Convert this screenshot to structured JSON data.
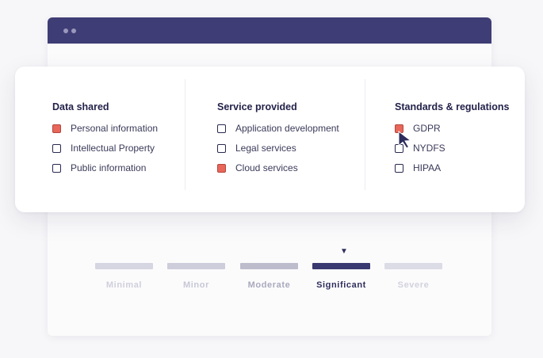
{
  "panel": {
    "columns": [
      {
        "title": "Data shared",
        "options": [
          {
            "label": "Personal information",
            "checked": true
          },
          {
            "label": "Intellectual Property",
            "checked": false
          },
          {
            "label": "Public information",
            "checked": false
          }
        ]
      },
      {
        "title": "Service provided",
        "options": [
          {
            "label": "Application development",
            "checked": false
          },
          {
            "label": "Legal services",
            "checked": false
          },
          {
            "label": "Cloud services",
            "checked": true
          }
        ]
      },
      {
        "title": "Standards & regulations",
        "options": [
          {
            "label": "GDPR",
            "checked": true
          },
          {
            "label": "NYDFS",
            "checked": false
          },
          {
            "label": "HIPAA",
            "checked": false
          }
        ]
      }
    ]
  },
  "scale": {
    "marker_icon": "triangle-down-icon",
    "selected": "Significant",
    "levels": [
      {
        "label": "Minimal",
        "bar_color": "#d6d6e2",
        "text_color": "#cfcfdc"
      },
      {
        "label": "Minor",
        "bar_color": "#cdcddb",
        "text_color": "#c7c7d6"
      },
      {
        "label": "Moderate",
        "bar_color": "#bcbccd",
        "text_color": "#a9a9bd"
      },
      {
        "label": "Significant",
        "bar_color": "#3a3870",
        "text_color": "#2f2e5c"
      },
      {
        "label": "Severe",
        "bar_color": "#dcdce6",
        "text_color": "#d2d2de"
      }
    ]
  },
  "colors": {
    "titlebar": "#3f3d75",
    "checked_fill": "#e8675a",
    "heading_text": "#23224a"
  },
  "icons": {
    "cursor": "pointer-cursor-icon"
  }
}
